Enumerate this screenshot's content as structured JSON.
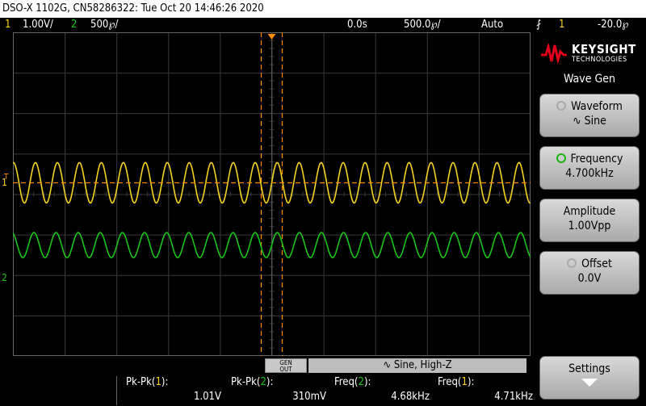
{
  "title": "DSO-X 1102G, CN58286322: Tue Oct 20 14:46:26 2020",
  "status": {
    "ch1_num": "1",
    "ch1_scale": "1.00V/",
    "ch2_num": "2",
    "ch2_scale": "500℘/",
    "time_delay": "0.0s",
    "time_scale": "500.0℘/",
    "trigger_mode": "Auto",
    "trigger_icon": "rising-edge-icon",
    "trigger_source": "1",
    "trigger_level": "-20.0℘"
  },
  "brand": {
    "name": "KEYSIGHT",
    "sub": "TECHNOLOGIES",
    "color": "#e2001a"
  },
  "menu_title": "Wave Gen",
  "softkeys": [
    {
      "label": "Waveform",
      "value": "Sine",
      "active": false
    },
    {
      "label": "Frequency",
      "value": "4.700kHz",
      "active": true
    },
    {
      "label": "Amplitude",
      "value": "1.00Vpp",
      "active": false
    },
    {
      "label": "Offset",
      "value": "0.0V",
      "active": false
    },
    {
      "label": "Settings",
      "value": "",
      "active": false
    }
  ],
  "genout": "GEN OUT",
  "wavegen_status": "Sine, High-Z",
  "measurements": [
    {
      "label_pre": "Pk-Pk(",
      "ch": "1",
      "label_post": "):",
      "value": "1.01V",
      "channel_color": "#f5d31f"
    },
    {
      "label_pre": "Pk-Pk(",
      "ch": "2",
      "label_post": "):",
      "value": "310mV",
      "channel_color": "#19c519"
    },
    {
      "label_pre": "Freq(",
      "ch": "2",
      "label_post": "):",
      "value": "4.68kHz",
      "channel_color": "#19c519"
    },
    {
      "label_pre": "Freq(",
      "ch": "1",
      "label_post": "):",
      "value": "4.71kHz",
      "channel_color": "#f5d31f"
    }
  ],
  "waveforms": {
    "ch1": {
      "color": "#f5d31f",
      "amplitude_v": 0.5,
      "frequency_khz": 4.71,
      "offset_div": 0.28
    },
    "ch2": {
      "color": "#19c519",
      "amplitude_v": 0.155,
      "frequency_khz": 4.68,
      "offset_div": -1.26
    }
  },
  "colors": {
    "grid": "#3a3a3a",
    "trigger": "#ff8c00",
    "ch1": "#f5d31f",
    "ch2": "#19c519"
  }
}
